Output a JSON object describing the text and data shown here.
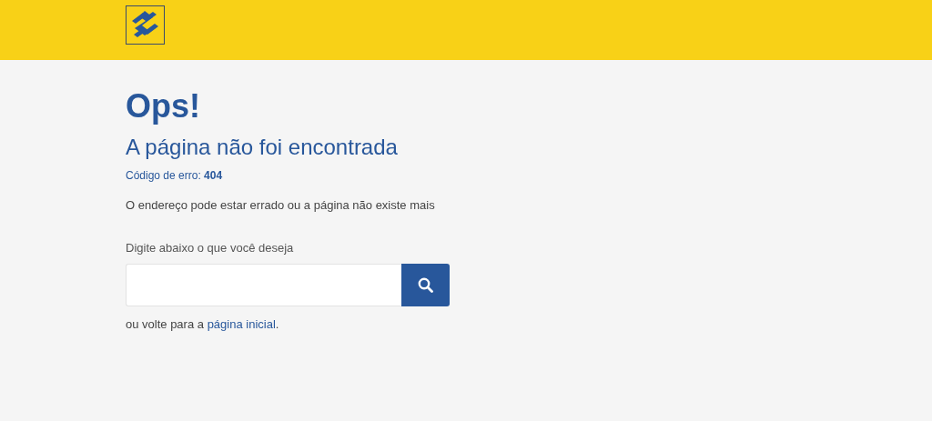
{
  "error": {
    "title": "Ops!",
    "subtitle": "A página não foi encontrada",
    "code": "Código de erro: **404**",
    "message": "O endereço pode estar errado ou a página não existe mais"
  },
  "search": {
    "label": "Digite abaixo o que você deseja"
  },
  "back": {
    "before": "ou volte para a ",
    "link": "página inicial",
    "after": "."
  }
}
